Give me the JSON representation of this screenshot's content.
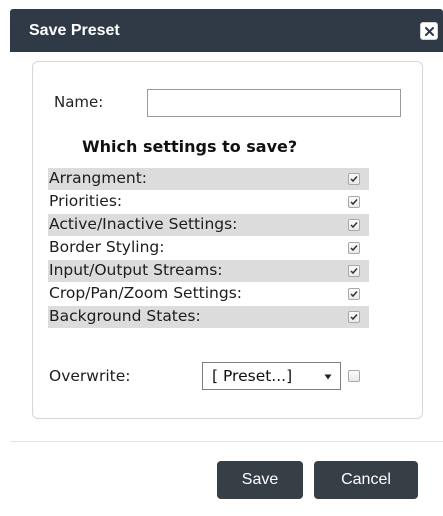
{
  "dialog": {
    "title": "Save Preset"
  },
  "form": {
    "name_label": "Name:",
    "name_value": "",
    "section_title": "Which settings to save?",
    "settings": [
      {
        "label": "Arrangment:",
        "checked": true
      },
      {
        "label": "Priorities:",
        "checked": true
      },
      {
        "label": "Active/Inactive Settings:",
        "checked": true
      },
      {
        "label": "Border Styling:",
        "checked": true
      },
      {
        "label": "Input/Output Streams:",
        "checked": true
      },
      {
        "label": "Crop/Pan/Zoom Settings:",
        "checked": true
      },
      {
        "label": "Background States:",
        "checked": true
      }
    ],
    "overwrite_label": "Overwrite:",
    "overwrite_select_value": "[ Preset...]",
    "overwrite_checked": false
  },
  "footer": {
    "save_label": "Save",
    "cancel_label": "Cancel"
  },
  "colors": {
    "titlebar": "#2f3a46",
    "button": "#363e46",
    "row_shade": "#dcdcdc"
  }
}
